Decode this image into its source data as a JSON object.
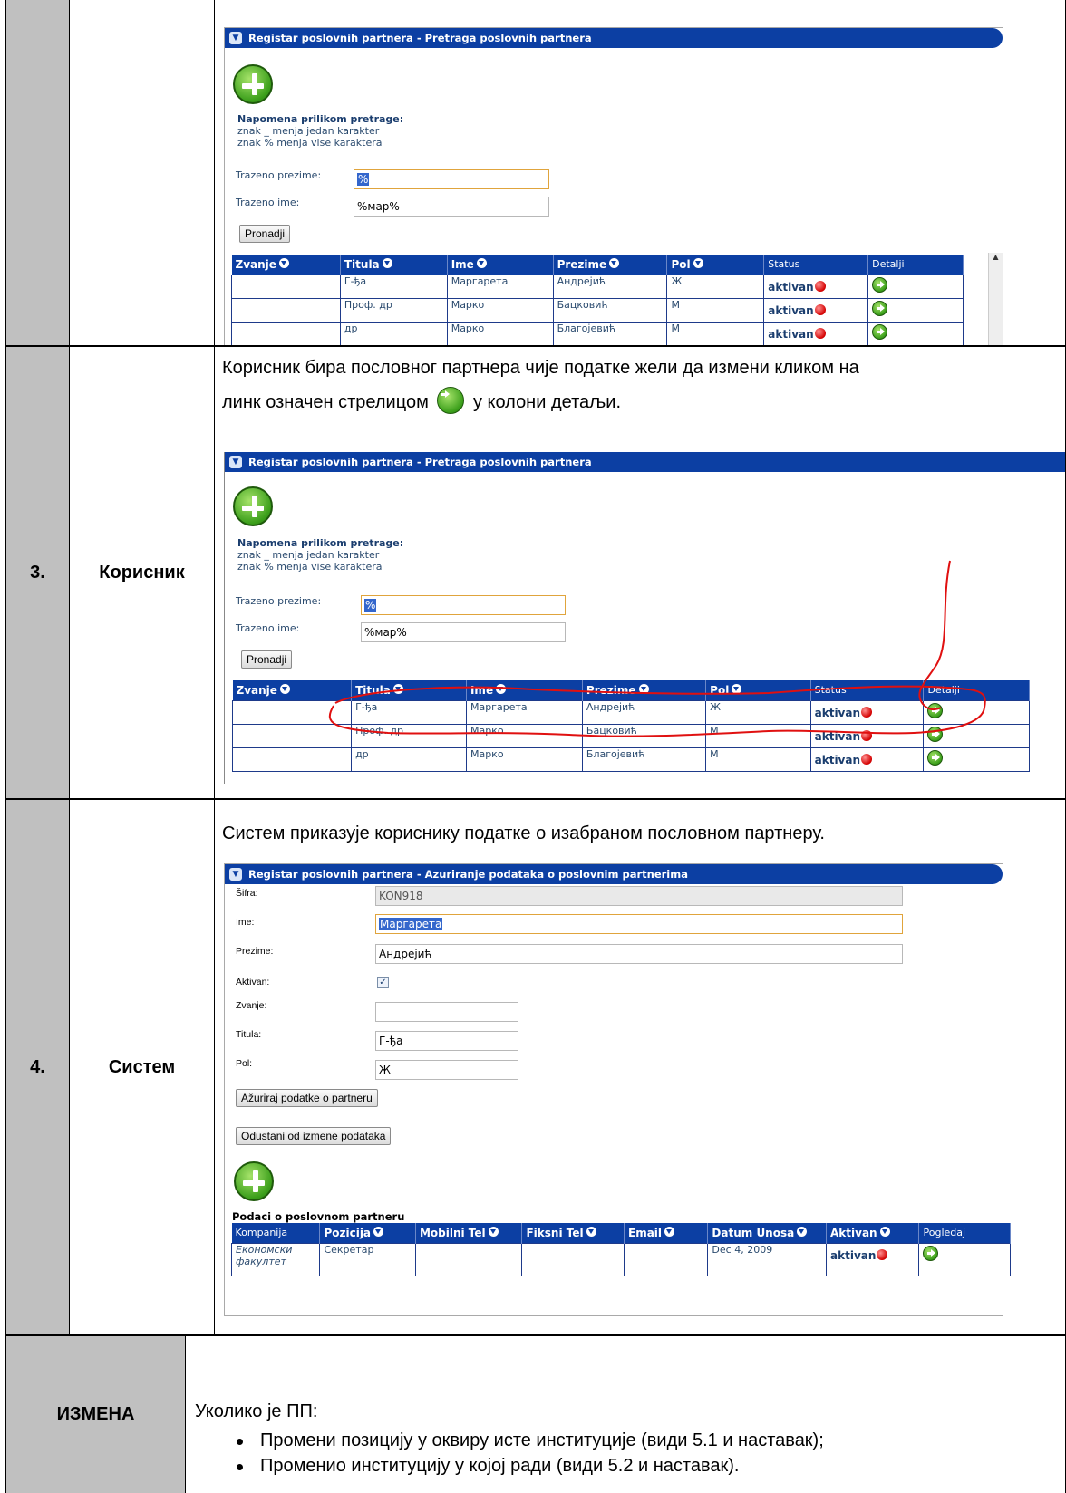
{
  "search_screen": {
    "header": "Registar poslovnih partnera - Pretraga poslovnih partnera",
    "note_title": "Napomena prilikom pretrage:",
    "note_line1": "znak _ menja jedan karakter",
    "note_line2": "znak % menja vise karaktera",
    "surname_label": "Trazeno prezime:",
    "surname_value": "%",
    "name_label": "Trazeno ime:",
    "name_value": "%мар%",
    "search_button": "Pronadji",
    "columns": [
      "Zvanje",
      "Titula",
      "Ime",
      "Prezime",
      "Pol",
      "Status",
      "Detalji"
    ],
    "rows": [
      {
        "zvanje": "",
        "titula": "Г-ђа",
        "ime": "Маргарета",
        "prezime": "Андрејић",
        "pol": "Ж",
        "status": "aktivan"
      },
      {
        "zvanje": "",
        "titula": "Проф. др",
        "ime": "Марко",
        "prezime": "Бацковић",
        "pol": "М",
        "status": "aktivan"
      },
      {
        "zvanje": "",
        "titula": "др",
        "ime": "Марко",
        "prezime": "Благојевић",
        "pol": "М",
        "status": "aktivan"
      }
    ]
  },
  "step3": {
    "number": "3.",
    "actor": "Корисник",
    "text_part1": "Корисник бира пословног партнера чије податке жели да измени кликом на",
    "text_part2a": "линк означен стрелицом",
    "text_part2b": "у колони детаљи."
  },
  "step4": {
    "number": "4.",
    "actor": "Систем",
    "text": "Систем приказује кориснику податке о изабраном пословном партнеру.",
    "header": "Registar poslovnih partnera - Azuriranje podataka o poslovnim partnerima",
    "fields": {
      "sifra_label": "Šifra:",
      "sifra_value": "KON918",
      "ime_label": "Ime:",
      "ime_value": "Маргарета",
      "prezime_label": "Prezime:",
      "prezime_value": "Андрејић",
      "aktivan_label": "Aktivan:",
      "aktivan_checked": true,
      "zvanje_label": "Zvanje:",
      "zvanje_value": "",
      "titula_label": "Titula:",
      "titula_value": "Г-ђа",
      "pol_label": "Pol:",
      "pol_value": "Ж"
    },
    "update_button": "Ažuriraj podatke o partneru",
    "cancel_button": "Odustani od izmene podataka",
    "partner_section_title": "Podaci o poslovnom partneru",
    "partner_columns": [
      "Kompanija",
      "Pozicija",
      "Mobilni Tel",
      "Fiksni Tel",
      "Email",
      "Datum Unosa",
      "Aktivan",
      "Pogledaj"
    ],
    "partner_row": {
      "kompanija": "Економски факултет",
      "pozicija": "Секретар",
      "mobilni": "",
      "fiksni": "",
      "email": "",
      "datum": "Dec 4, 2009",
      "aktivan": "aktivan"
    }
  },
  "change": {
    "label": "ИЗМЕНА",
    "intro": "Уколико је ПП:",
    "item1": "Промени позицију у оквиру исте институције (види 5.1 и наставак);",
    "item2": "Променио институцију у којој ради (види 5.2 и наставак)."
  }
}
